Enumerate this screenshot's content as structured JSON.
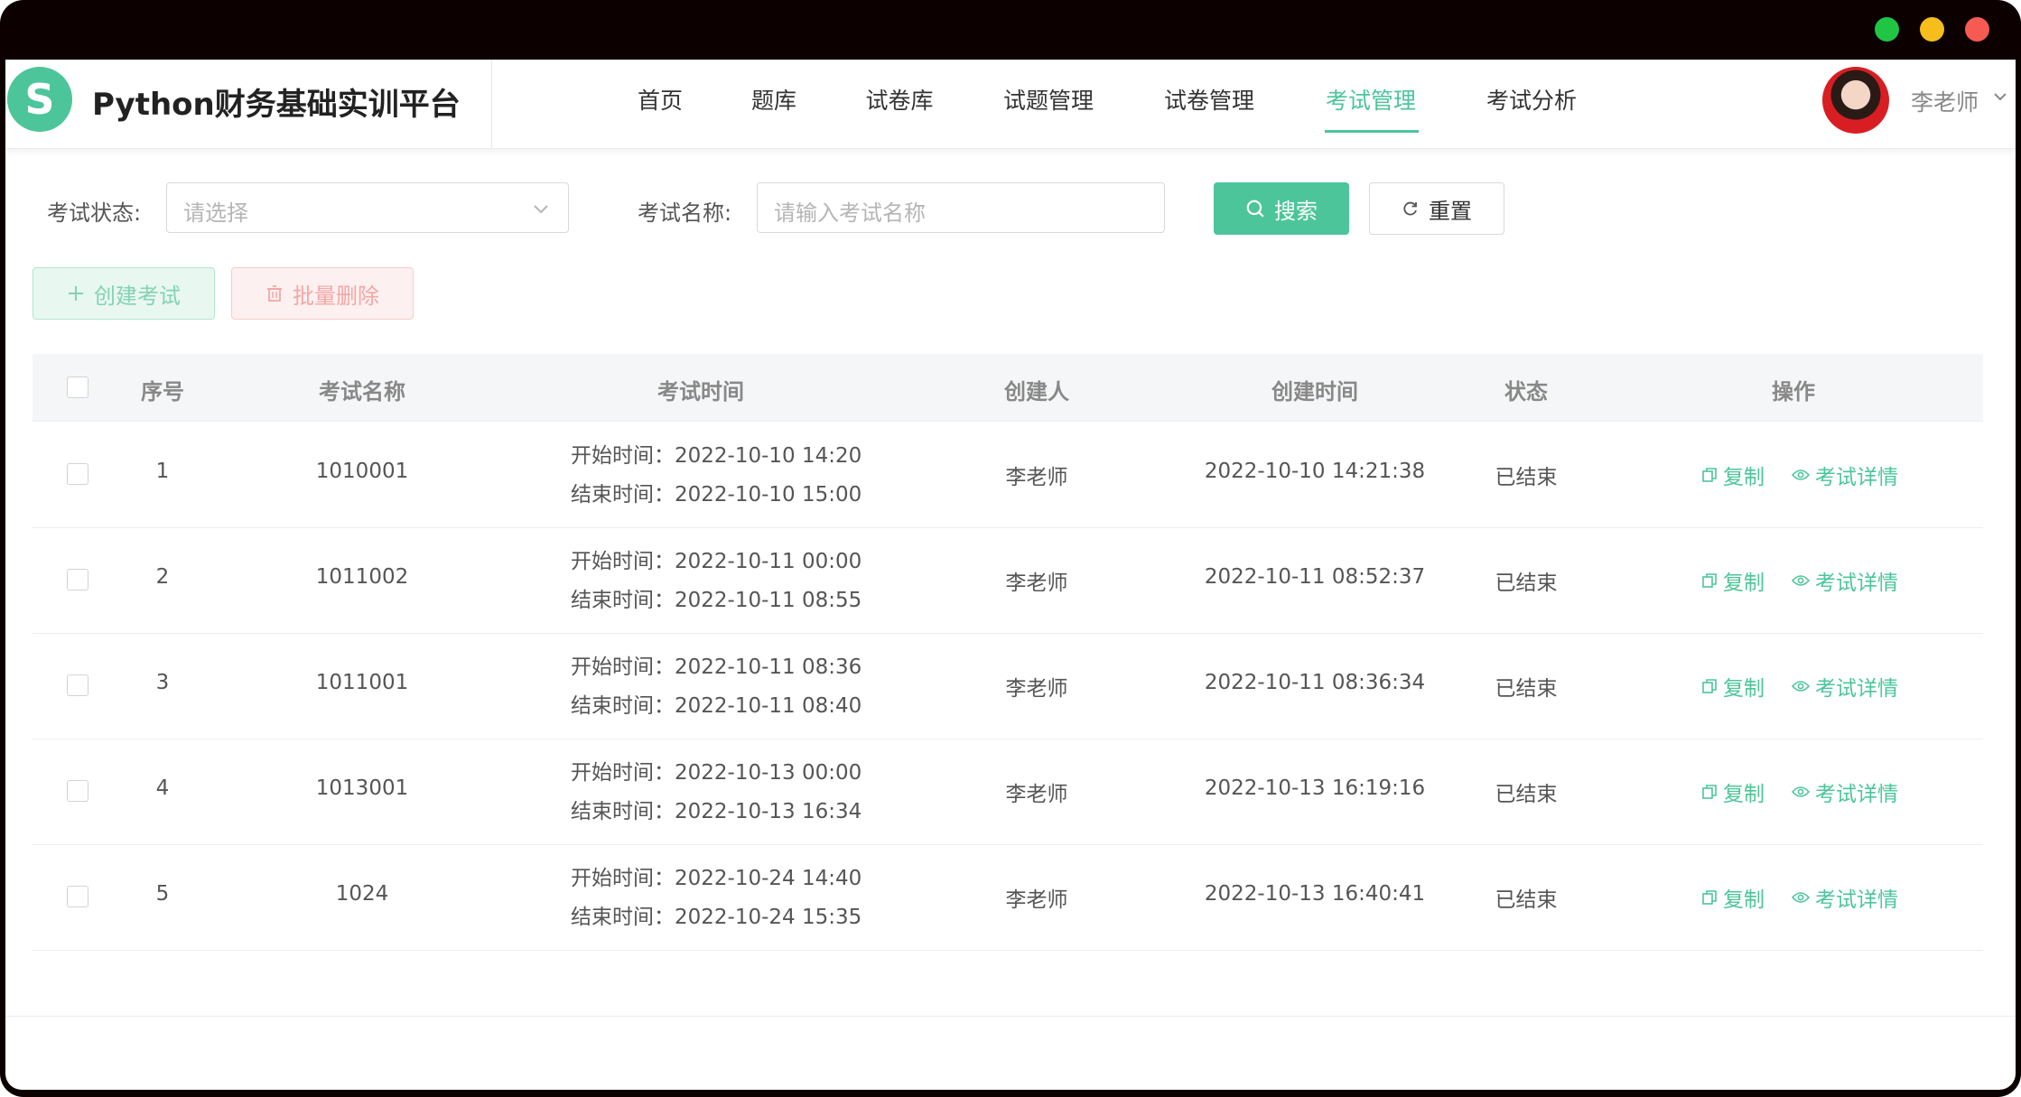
{
  "window": {
    "controls": [
      {
        "name": "maximize",
        "color": "#1fc543"
      },
      {
        "name": "minimize",
        "color": "#f5be1c"
      },
      {
        "name": "close",
        "color": "#f65a52"
      }
    ]
  },
  "header": {
    "logo_letter": "S",
    "app_title": "Python财务基础实训平台",
    "nav": [
      {
        "label": "首页",
        "active": false
      },
      {
        "label": "题库",
        "active": false
      },
      {
        "label": "试卷库",
        "active": false
      },
      {
        "label": "试题管理",
        "active": false
      },
      {
        "label": "试卷管理",
        "active": false
      },
      {
        "label": "考试管理",
        "active": true
      },
      {
        "label": "考试分析",
        "active": false
      }
    ],
    "user_name": "李老师"
  },
  "filters": {
    "status_label": "考试状态:",
    "status_placeholder": "请选择",
    "name_label": "考试名称:",
    "name_placeholder": "请输入考试名称",
    "search_label": "搜索",
    "reset_label": "重置"
  },
  "actions": {
    "create_label": "创建考试",
    "batch_delete_label": "批量删除"
  },
  "table": {
    "columns": [
      "序号",
      "考试名称",
      "考试时间",
      "创建人",
      "创建时间",
      "状态",
      "操作"
    ],
    "rows": [
      {
        "index": "1",
        "name": "1010001",
        "start": "开始时间：2022-10-10 14:20",
        "end": "结束时间：2022-10-10 15:00",
        "creator": "李老师",
        "created": "2022-10-10 14:21:38",
        "status": "已结束",
        "copy": "复制",
        "detail": "考试详情"
      },
      {
        "index": "2",
        "name": "1011002",
        "start": "开始时间：2022-10-11 00:00",
        "end": "结束时间：2022-10-11 08:55",
        "creator": "李老师",
        "created": "2022-10-11 08:52:37",
        "status": "已结束",
        "copy": "复制",
        "detail": "考试详情"
      },
      {
        "index": "3",
        "name": "1011001",
        "start": "开始时间：2022-10-11 08:36",
        "end": "结束时间：2022-10-11 08:40",
        "creator": "李老师",
        "created": "2022-10-11 08:36:34",
        "status": "已结束",
        "copy": "复制",
        "detail": "考试详情"
      },
      {
        "index": "4",
        "name": "1013001",
        "start": "开始时间：2022-10-13 00:00",
        "end": "结束时间：2022-10-13 16:34",
        "creator": "李老师",
        "created": "2022-10-13 16:19:16",
        "status": "已结束",
        "copy": "复制",
        "detail": "考试详情"
      },
      {
        "index": "5",
        "name": "1024",
        "start": "开始时间：2022-10-24 14:40",
        "end": "结束时间：2022-10-24 15:35",
        "creator": "李老师",
        "created": "2022-10-13 16:40:41",
        "status": "已结束",
        "copy": "复制",
        "detail": "考试详情"
      }
    ]
  },
  "colors": {
    "accent": "#4cc59a",
    "danger_light": "#f5a6a6"
  }
}
